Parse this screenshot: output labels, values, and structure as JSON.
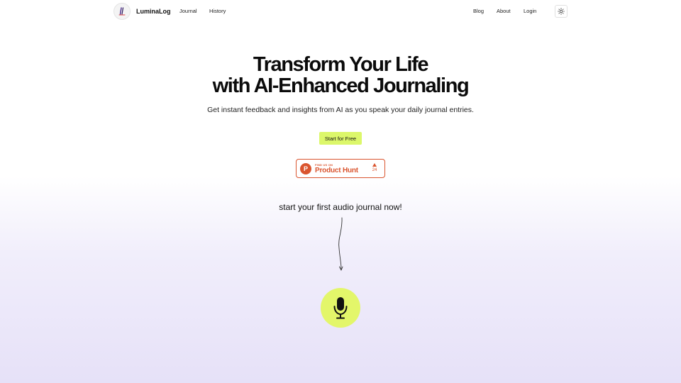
{
  "header": {
    "brand": "LuminaLog",
    "nav_left": [
      {
        "label": "Journal"
      },
      {
        "label": "History"
      }
    ],
    "nav_right": [
      {
        "label": "Blog"
      },
      {
        "label": "About"
      },
      {
        "label": "Login"
      }
    ],
    "theme_toggle_icon": "sun-icon"
  },
  "hero": {
    "title_line1": "Transform Your Life",
    "title_line2": "with AI-Enhanced Journaling",
    "subtitle": "Get instant feedback and insights from AI as you speak your daily journal entries.",
    "cta_label": "Start for Free"
  },
  "product_hunt": {
    "small_text": "FIND US ON",
    "name": "Product Hunt",
    "logo_letter": "P",
    "upvotes": "24",
    "color": "#da552f"
  },
  "record": {
    "prompt": "start your first audio journal now!",
    "mic_icon": "microphone-icon",
    "mic_color": "#e3f66a"
  },
  "colors": {
    "accent": "#dcf76a",
    "gradient_bottom": "#e6e1f8"
  }
}
